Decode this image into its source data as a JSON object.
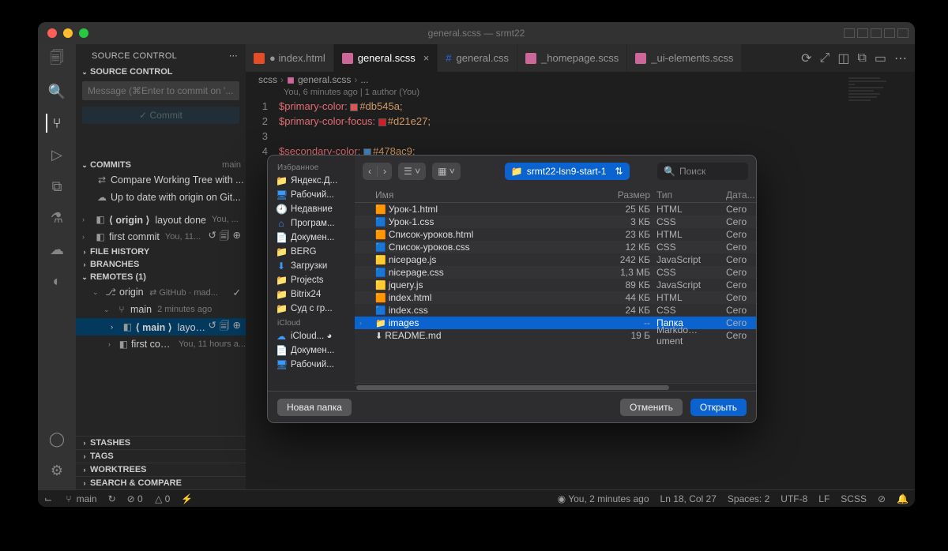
{
  "window": {
    "title": "general.scss — srmt22"
  },
  "activity_bar": [
    "files",
    "search",
    "source-control",
    "debug",
    "extensions",
    "test",
    "remote",
    "git"
  ],
  "sidebar": {
    "title": "SOURCE CONTROL",
    "sections": {
      "source_control": {
        "label": "SOURCE CONTROL",
        "message_placeholder": "Message (⌘Enter to commit on '...",
        "commit_label": "✓ Commit"
      },
      "commits": {
        "label": "COMMITS",
        "branch": "main",
        "items": [
          {
            "icon": "compare",
            "text": "Compare Working Tree with ..."
          },
          {
            "icon": "cloud",
            "text": "Up to date with origin on Git..."
          }
        ],
        "history": [
          {
            "branch": "⟨ origin ⟩",
            "msg": "layout done",
            "meta": "You, ...",
            "actions": true
          },
          {
            "branch": "",
            "msg": "first commit",
            "meta": "You, 11...",
            "actions": true
          }
        ]
      },
      "file_history": {
        "label": "FILE HISTORY"
      },
      "branches": {
        "label": "BRANCHES"
      },
      "remotes": {
        "label": "REMOTES (1)",
        "origin": {
          "label": "origin",
          "meta": "⇄ GitHub · mad...",
          "check": "✓"
        },
        "branch": {
          "name": "main",
          "time": "2 minutes ago"
        },
        "items": [
          {
            "branch": "⟨ main ⟩",
            "msg": "layout...",
            "actions": true,
            "selected": true
          },
          {
            "branch": "",
            "msg": "first commit",
            "meta": "You, 11 hours a..."
          }
        ]
      },
      "stashes": {
        "label": "STASHES"
      },
      "tags": {
        "label": "TAGS"
      },
      "worktrees": {
        "label": "WORKTREES"
      },
      "search_compare": {
        "label": "SEARCH & COMPARE"
      }
    }
  },
  "tabs": [
    {
      "name": "index.html",
      "type": "html",
      "active": false,
      "dirty": true
    },
    {
      "name": "general.scss",
      "type": "scss",
      "active": true,
      "dirty": false
    },
    {
      "name": "general.css",
      "type": "css",
      "active": false,
      "dirty": false
    },
    {
      "name": "_homepage.scss",
      "type": "scss",
      "active": false,
      "dirty": false
    },
    {
      "name": "_ui-elements.scss",
      "type": "scss",
      "active": false,
      "dirty": false
    }
  ],
  "breadcrumb": [
    "scss",
    "general.scss",
    "..."
  ],
  "codelens": "You, 6 minutes ago | 1 author (You)",
  "code": {
    "1": {
      "var": "$primary-color:",
      "swatch": "#db545a",
      "val": "#db545a;"
    },
    "2": {
      "var": "$primary-color-focus:",
      "swatch": "#d21e27",
      "val": "#d21e27;"
    },
    "3": {
      "var": "",
      "val": ""
    },
    "4": {
      "var": "$secondary-color:",
      "swatch": "#478ac9",
      "val": "#478ac9;"
    }
  },
  "statusbar": {
    "branch": "main",
    "sync": "↻",
    "errors": "⊘ 0",
    "warnings": "△ 0",
    "port": "⚡",
    "blame": "You, 2 minutes ago",
    "cursor": "Ln 18, Col 27",
    "spaces": "Spaces: 2",
    "encoding": "UTF-8",
    "eol": "LF",
    "lang": "SCSS",
    "prettier": "⊘",
    "bell": "🔔"
  },
  "dialog": {
    "sidebar": {
      "favorites_label": "Избранное",
      "favorites": [
        {
          "icon": "📁",
          "text": "Яндекс.Д..."
        },
        {
          "icon": "🖥",
          "text": "Рабочий..."
        },
        {
          "icon": "🕘",
          "text": "Недавние"
        },
        {
          "icon": "⌂",
          "text": "Програм..."
        },
        {
          "icon": "📄",
          "text": "Докумен..."
        },
        {
          "icon": "📁",
          "text": "BERG"
        },
        {
          "icon": "⬇",
          "text": "Загрузки"
        },
        {
          "icon": "📁",
          "text": "Projects"
        },
        {
          "icon": "📁",
          "text": "Bitrix24"
        },
        {
          "icon": "📁",
          "text": "Суд с гр..."
        }
      ],
      "icloud_label": "iCloud",
      "icloud": [
        {
          "icon": "☁",
          "text": "iCloud...  ◕"
        },
        {
          "icon": "📄",
          "text": "Докумен..."
        },
        {
          "icon": "🖥",
          "text": "Рабочий..."
        }
      ]
    },
    "toolbar": {
      "path": "srmt22-lsn9-start-1",
      "search_placeholder": "Поиск"
    },
    "columns": {
      "name": "Имя",
      "size": "Размер",
      "type": "Тип",
      "date": "Дата..."
    },
    "files": [
      {
        "name": "Урок-1.html",
        "size": "25 КБ",
        "type": "HTML",
        "date": "Сего",
        "icon": "html"
      },
      {
        "name": "Урок-1.css",
        "size": "3 КБ",
        "type": "CSS",
        "date": "Сего",
        "icon": "css"
      },
      {
        "name": "Список-уроков.html",
        "size": "23 КБ",
        "type": "HTML",
        "date": "Сего",
        "icon": "html"
      },
      {
        "name": "Список-уроков.css",
        "size": "12 КБ",
        "type": "CSS",
        "date": "Сего",
        "icon": "css"
      },
      {
        "name": "nicepage.js",
        "size": "242 КБ",
        "type": "JavaScript",
        "date": "Сего",
        "icon": "js"
      },
      {
        "name": "nicepage.css",
        "size": "1,3 МБ",
        "type": "CSS",
        "date": "Сего",
        "icon": "css"
      },
      {
        "name": "jquery.js",
        "size": "89 КБ",
        "type": "JavaScript",
        "date": "Сего",
        "icon": "js"
      },
      {
        "name": "index.html",
        "size": "44 КБ",
        "type": "HTML",
        "date": "Сего",
        "icon": "html"
      },
      {
        "name": "index.css",
        "size": "24 КБ",
        "type": "CSS",
        "date": "Сего",
        "icon": "css"
      },
      {
        "name": "images",
        "size": "--",
        "type": "Папка",
        "date": "Сего",
        "icon": "folder",
        "selected": true,
        "disclose": true
      },
      {
        "name": "README.md",
        "size": "19 Б",
        "type": "Markdo…ument",
        "date": "Сего",
        "icon": "md"
      }
    ],
    "footer": {
      "newfolder": "Новая папка",
      "cancel": "Отменить",
      "open": "Открыть"
    }
  }
}
